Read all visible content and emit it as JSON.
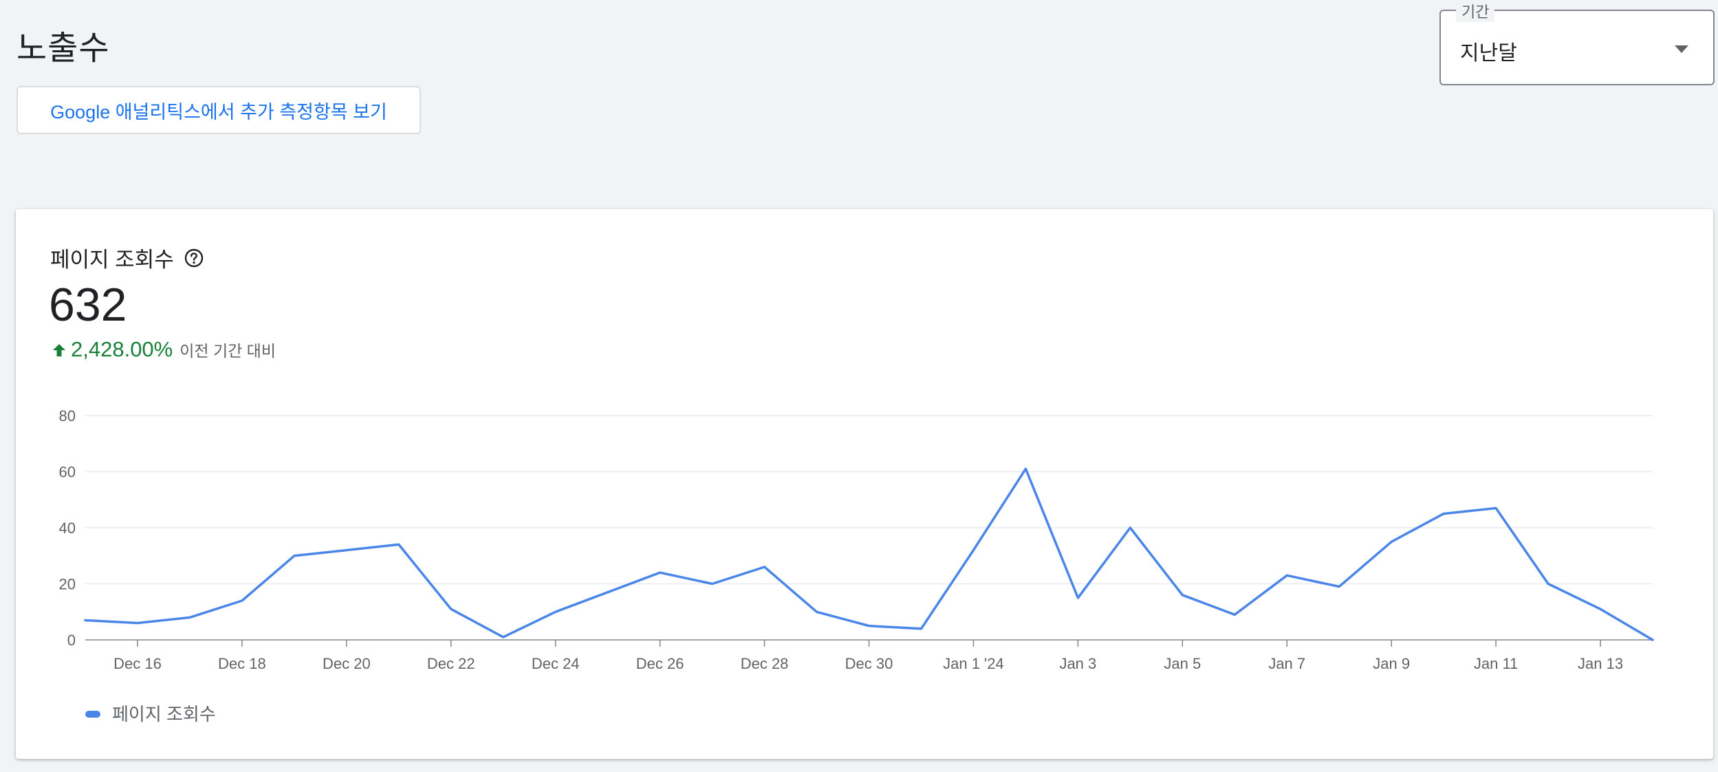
{
  "page": {
    "title": "노출수",
    "ga_button_label": "Google 애널리틱스에서 추가 측정항목 보기"
  },
  "period_select": {
    "label": "기간",
    "value": "지난달"
  },
  "metric_card": {
    "title": "페이지 조회수",
    "value": "632",
    "change": "2,428.00%",
    "change_label": "이전 기간 대비",
    "legend": "페이지 조회수",
    "icons": {
      "help": "help-circle-icon",
      "change": "arrow-up-icon"
    }
  },
  "colors": {
    "accent": "#1a73e8",
    "line": "#4a86e8",
    "positive": "#188038"
  },
  "chart_data": {
    "type": "line",
    "title": "",
    "xlabel": "",
    "ylabel": "",
    "ylim": [
      0,
      80
    ],
    "yticks": [
      0,
      20,
      40,
      60,
      80
    ],
    "grid": true,
    "legend_position": "bottom-left",
    "x": [
      "2023-12-15",
      "2023-12-16",
      "2023-12-17",
      "2023-12-18",
      "2023-12-19",
      "2023-12-20",
      "2023-12-21",
      "2023-12-22",
      "2023-12-23",
      "2023-12-24",
      "2023-12-25",
      "2023-12-26",
      "2023-12-27",
      "2023-12-28",
      "2023-12-29",
      "2023-12-30",
      "2023-12-31",
      "2024-01-01",
      "2024-01-02",
      "2024-01-03",
      "2024-01-04",
      "2024-01-05",
      "2024-01-06",
      "2024-01-07",
      "2024-01-08",
      "2024-01-09",
      "2024-01-10",
      "2024-01-11",
      "2024-01-12",
      "2024-01-13",
      "2024-01-14"
    ],
    "xticks": [
      {
        "x": "2023-12-16",
        "label": "Dec 16"
      },
      {
        "x": "2023-12-18",
        "label": "Dec 18"
      },
      {
        "x": "2023-12-20",
        "label": "Dec 20"
      },
      {
        "x": "2023-12-22",
        "label": "Dec 22"
      },
      {
        "x": "2023-12-24",
        "label": "Dec 24"
      },
      {
        "x": "2023-12-26",
        "label": "Dec 26"
      },
      {
        "x": "2023-12-28",
        "label": "Dec 28"
      },
      {
        "x": "2023-12-30",
        "label": "Dec 30"
      },
      {
        "x": "2024-01-01",
        "label": "Jan 1 '24"
      },
      {
        "x": "2024-01-03",
        "label": "Jan 3"
      },
      {
        "x": "2024-01-05",
        "label": "Jan 5"
      },
      {
        "x": "2024-01-07",
        "label": "Jan 7"
      },
      {
        "x": "2024-01-09",
        "label": "Jan 9"
      },
      {
        "x": "2024-01-11",
        "label": "Jan 11"
      },
      {
        "x": "2024-01-13",
        "label": "Jan 13"
      }
    ],
    "series": [
      {
        "name": "페이지 조회수",
        "values": [
          7,
          6,
          8,
          14,
          30,
          32,
          34,
          11,
          1,
          10,
          17,
          24,
          20,
          26,
          10,
          5,
          4,
          32,
          61,
          15,
          40,
          16,
          9,
          23,
          19,
          35,
          45,
          47,
          20,
          11,
          0
        ]
      }
    ]
  }
}
